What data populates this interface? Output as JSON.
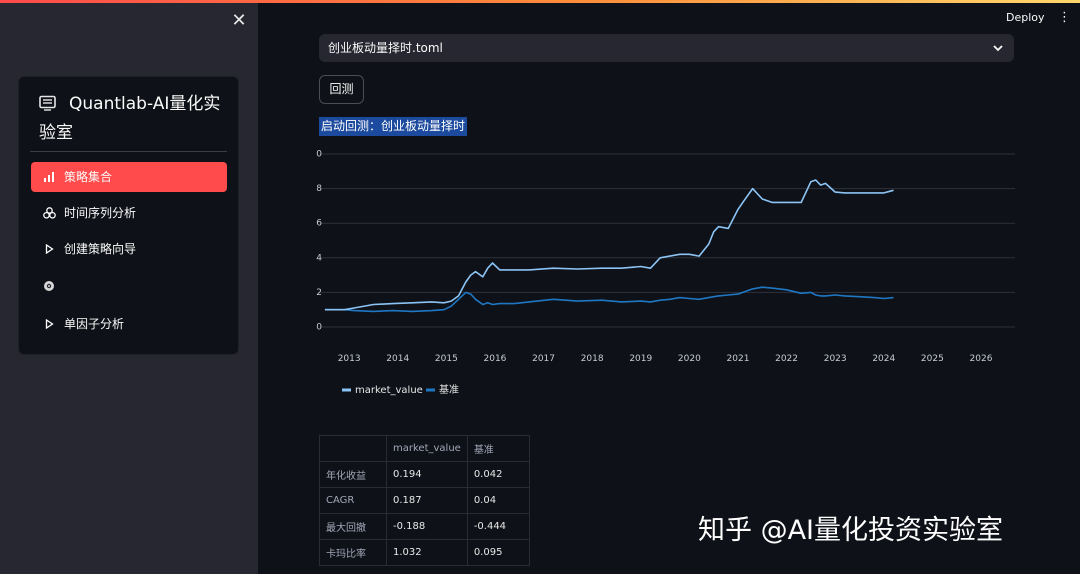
{
  "sidebar": {
    "title": "Quantlab-AI量化实验室",
    "items": [
      {
        "label": "策略集合",
        "icon": "bar-chart-icon",
        "active": true
      },
      {
        "label": "时间序列分析",
        "icon": "three-circles-icon",
        "active": false
      },
      {
        "label": "创建策略向导",
        "icon": "play-triangle-icon",
        "active": false
      },
      {
        "label": "",
        "icon": "gear-globe-icon",
        "active": false
      },
      {
        "label": "单因子分析",
        "icon": "play-triangle-icon",
        "active": false
      }
    ]
  },
  "header": {
    "deploy_label": "Deploy"
  },
  "main": {
    "select_value": "创业板动量择时.toml",
    "backtest_button": "回测",
    "status_text": "启动回测：创业板动量择时"
  },
  "chart_data": {
    "type": "line",
    "x_ticks": [
      "2013",
      "2014",
      "2015",
      "2016",
      "2017",
      "2018",
      "2019",
      "2020",
      "2021",
      "2022",
      "2023",
      "2024",
      "2025",
      "2026"
    ],
    "y_ticks": [
      "0",
      "2",
      "4",
      "6",
      "8",
      "0"
    ],
    "xlim": [
      2012.4,
      2026.7
    ],
    "ylim": [
      0,
      10
    ],
    "legend_position": "bottom-left",
    "series": [
      {
        "name": "market_value",
        "color": "#8cc4f5",
        "x": [
          2012.5,
          2012.9,
          2013.1,
          2013.5,
          2013.9,
          2014.3,
          2014.7,
          2014.95,
          2015.1,
          2015.25,
          2015.4,
          2015.5,
          2015.6,
          2015.75,
          2015.85,
          2015.95,
          2016.1,
          2016.4,
          2016.7,
          2017.2,
          2017.7,
          2018.2,
          2018.6,
          2019.0,
          2019.2,
          2019.4,
          2019.6,
          2019.8,
          2020.0,
          2020.2,
          2020.4,
          2020.5,
          2020.6,
          2020.8,
          2021.0,
          2021.1,
          2021.3,
          2021.5,
          2021.7,
          2022.0,
          2022.3,
          2022.5,
          2022.6,
          2022.7,
          2022.8,
          2023.0,
          2023.2,
          2023.5,
          2023.8,
          2024.0,
          2024.2
        ],
        "values": [
          1.0,
          1.0,
          1.1,
          1.3,
          1.35,
          1.4,
          1.45,
          1.4,
          1.5,
          1.8,
          2.6,
          3.0,
          3.2,
          2.9,
          3.4,
          3.7,
          3.3,
          3.3,
          3.3,
          3.4,
          3.35,
          3.4,
          3.4,
          3.5,
          3.4,
          4.0,
          4.1,
          4.2,
          4.2,
          4.1,
          4.8,
          5.5,
          5.8,
          5.7,
          6.8,
          7.2,
          8.0,
          7.4,
          7.2,
          7.2,
          7.2,
          8.4,
          8.5,
          8.2,
          8.3,
          7.8,
          7.75,
          7.75,
          7.75,
          7.75,
          7.9
        ]
      },
      {
        "name": "基准",
        "color": "#1f77c4",
        "x": [
          2012.5,
          2012.9,
          2013.1,
          2013.5,
          2013.9,
          2014.3,
          2014.7,
          2014.95,
          2015.1,
          2015.25,
          2015.4,
          2015.5,
          2015.6,
          2015.75,
          2015.85,
          2015.95,
          2016.1,
          2016.4,
          2016.7,
          2017.2,
          2017.7,
          2018.2,
          2018.6,
          2019.0,
          2019.2,
          2019.4,
          2019.6,
          2019.8,
          2020.0,
          2020.2,
          2020.4,
          2020.5,
          2020.6,
          2020.8,
          2021.0,
          2021.1,
          2021.3,
          2021.5,
          2021.7,
          2022.0,
          2022.3,
          2022.5,
          2022.6,
          2022.7,
          2022.8,
          2023.0,
          2023.2,
          2023.5,
          2023.8,
          2024.0,
          2024.2
        ],
        "values": [
          1.0,
          1.0,
          0.95,
          0.9,
          0.95,
          0.9,
          0.95,
          1.0,
          1.2,
          1.6,
          2.0,
          1.9,
          1.6,
          1.3,
          1.4,
          1.3,
          1.35,
          1.35,
          1.45,
          1.6,
          1.5,
          1.55,
          1.45,
          1.5,
          1.45,
          1.55,
          1.6,
          1.7,
          1.65,
          1.6,
          1.7,
          1.75,
          1.8,
          1.85,
          1.9,
          2.0,
          2.2,
          2.3,
          2.25,
          2.15,
          1.95,
          2.0,
          1.85,
          1.8,
          1.8,
          1.85,
          1.8,
          1.75,
          1.7,
          1.65,
          1.7
        ]
      }
    ]
  },
  "table": {
    "headers": [
      "",
      "market_value",
      "基准"
    ],
    "rows": [
      [
        "年化收益",
        "0.194",
        "0.042"
      ],
      [
        "CAGR",
        "0.187",
        "0.04"
      ],
      [
        "最大回撤",
        "-0.188",
        "-0.444"
      ],
      [
        "卡玛比率",
        "1.032",
        "0.095"
      ]
    ]
  },
  "watermark": "知乎 @AI量化投资实验室"
}
